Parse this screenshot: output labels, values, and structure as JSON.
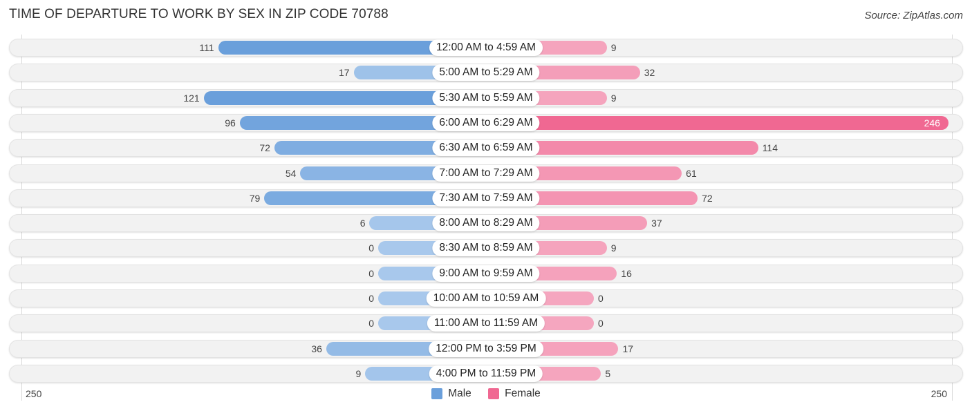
{
  "title": "TIME OF DEPARTURE TO WORK BY SEX IN ZIP CODE 70788",
  "source": "Source: ZipAtlas.com",
  "colors": {
    "male": "#6a9fdb",
    "male_light": "#a8c8ec",
    "female": "#f06892",
    "female_light": "#f5a6bf"
  },
  "chart_data": {
    "type": "bar",
    "orientation": "horizontal-diverging",
    "title": "TIME OF DEPARTURE TO WORK BY SEX IN ZIP CODE 70788",
    "categories": [
      "12:00 AM to 4:59 AM",
      "5:00 AM to 5:29 AM",
      "5:30 AM to 5:59 AM",
      "6:00 AM to 6:29 AM",
      "6:30 AM to 6:59 AM",
      "7:00 AM to 7:29 AM",
      "7:30 AM to 7:59 AM",
      "8:00 AM to 8:29 AM",
      "8:30 AM to 8:59 AM",
      "9:00 AM to 9:59 AM",
      "10:00 AM to 10:59 AM",
      "11:00 AM to 11:59 AM",
      "12:00 PM to 3:59 PM",
      "4:00 PM to 11:59 PM"
    ],
    "series": [
      {
        "name": "Male",
        "values": [
          111,
          17,
          121,
          96,
          72,
          54,
          79,
          6,
          0,
          0,
          0,
          0,
          36,
          9
        ]
      },
      {
        "name": "Female",
        "values": [
          9,
          32,
          9,
          246,
          114,
          61,
          72,
          37,
          9,
          16,
          0,
          0,
          17,
          5
        ]
      }
    ],
    "axis": {
      "left_tick": "250",
      "right_tick": "250",
      "range": [
        0,
        250
      ]
    },
    "legend": {
      "position": "bottom-center",
      "entries": [
        "Male",
        "Female"
      ]
    }
  }
}
